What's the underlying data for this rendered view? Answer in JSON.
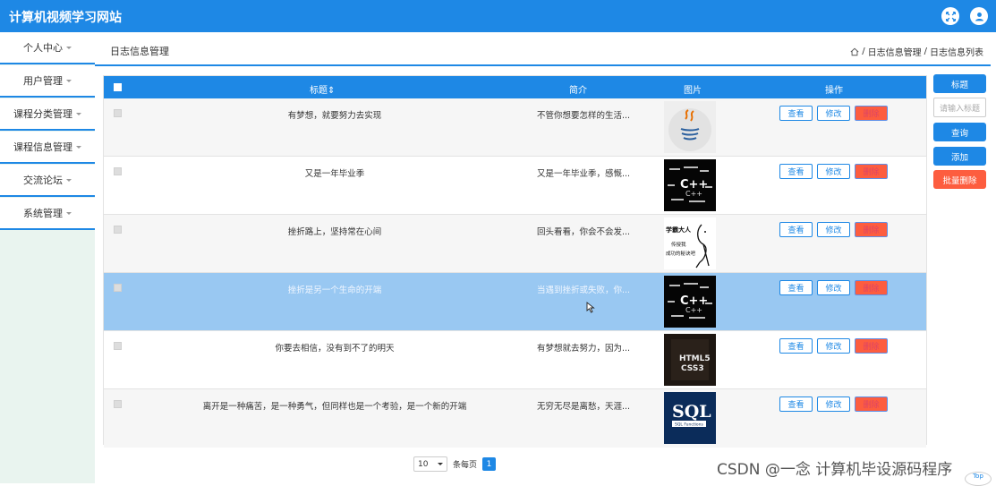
{
  "app": {
    "title": "计算机视频学习网站"
  },
  "sidebar": {
    "items": [
      {
        "label": "个人中心"
      },
      {
        "label": "用户管理"
      },
      {
        "label": "课程分类管理"
      },
      {
        "label": "课程信息管理"
      },
      {
        "label": "交流论坛"
      },
      {
        "label": "系统管理"
      }
    ]
  },
  "header": {
    "title": "日志信息管理",
    "breadcrumb": [
      "日志信息管理",
      "日志信息列表"
    ],
    "separator": "/"
  },
  "table": {
    "columns": {
      "title": "标题",
      "sort_mark": "⇕",
      "intro": "简介",
      "image": "图片",
      "actions": "操作"
    },
    "rows": [
      {
        "title": "有梦想，就要努力去实现",
        "intro": "不管你想要怎样的生活...",
        "image": "java-logo-icon"
      },
      {
        "title": "又是一年毕业季",
        "intro": "又是一年毕业季，感慨...",
        "image": "cpp-wordcloud"
      },
      {
        "title": "挫折路上，坚持常在心间",
        "intro": "回头看看，你会不会发...",
        "image": "sketch-figure"
      },
      {
        "title": "挫折是另一个生命的开端",
        "intro": "当遇到挫折或失败，你...",
        "image": "cpp-wordcloud"
      },
      {
        "title": "你要去相信，没有到不了的明天",
        "intro": "有梦想就去努力，因为...",
        "image": "html5-css3"
      },
      {
        "title": "离开是一种痛苦，是一种勇气，但同样也是一个考验，是一个新的开端",
        "intro": "无穷无尽是离愁，天涯...",
        "image": "sql-functions"
      }
    ],
    "actions": {
      "view": "查看",
      "edit": "修改",
      "delete": "删除"
    },
    "selected_row": 3
  },
  "thumbs": {
    "sketch_line1": "学霸大人",
    "sketch_line2": "传授我",
    "sketch_line3": "成功的秘诀吧",
    "html_text": "HTML5",
    "css_text": "CSS3",
    "sql_title": "SQL",
    "sql_sub": "SQL Functions"
  },
  "pagination": {
    "page_size": "10",
    "per_page_label": "条每页",
    "current_page": "1"
  },
  "right_panel": {
    "title_button": "标题",
    "search_placeholder": "请输入标题",
    "query_button": "查询",
    "add_button": "添加",
    "batch_delete_button": "批量删除"
  },
  "watermark": "CSDN @一念 计算机毕设源码程序",
  "back_to_top": "Top",
  "colors": {
    "primary": "#1e88e5",
    "danger": "#fd5d3f",
    "selected_row": "#99c8f2"
  }
}
